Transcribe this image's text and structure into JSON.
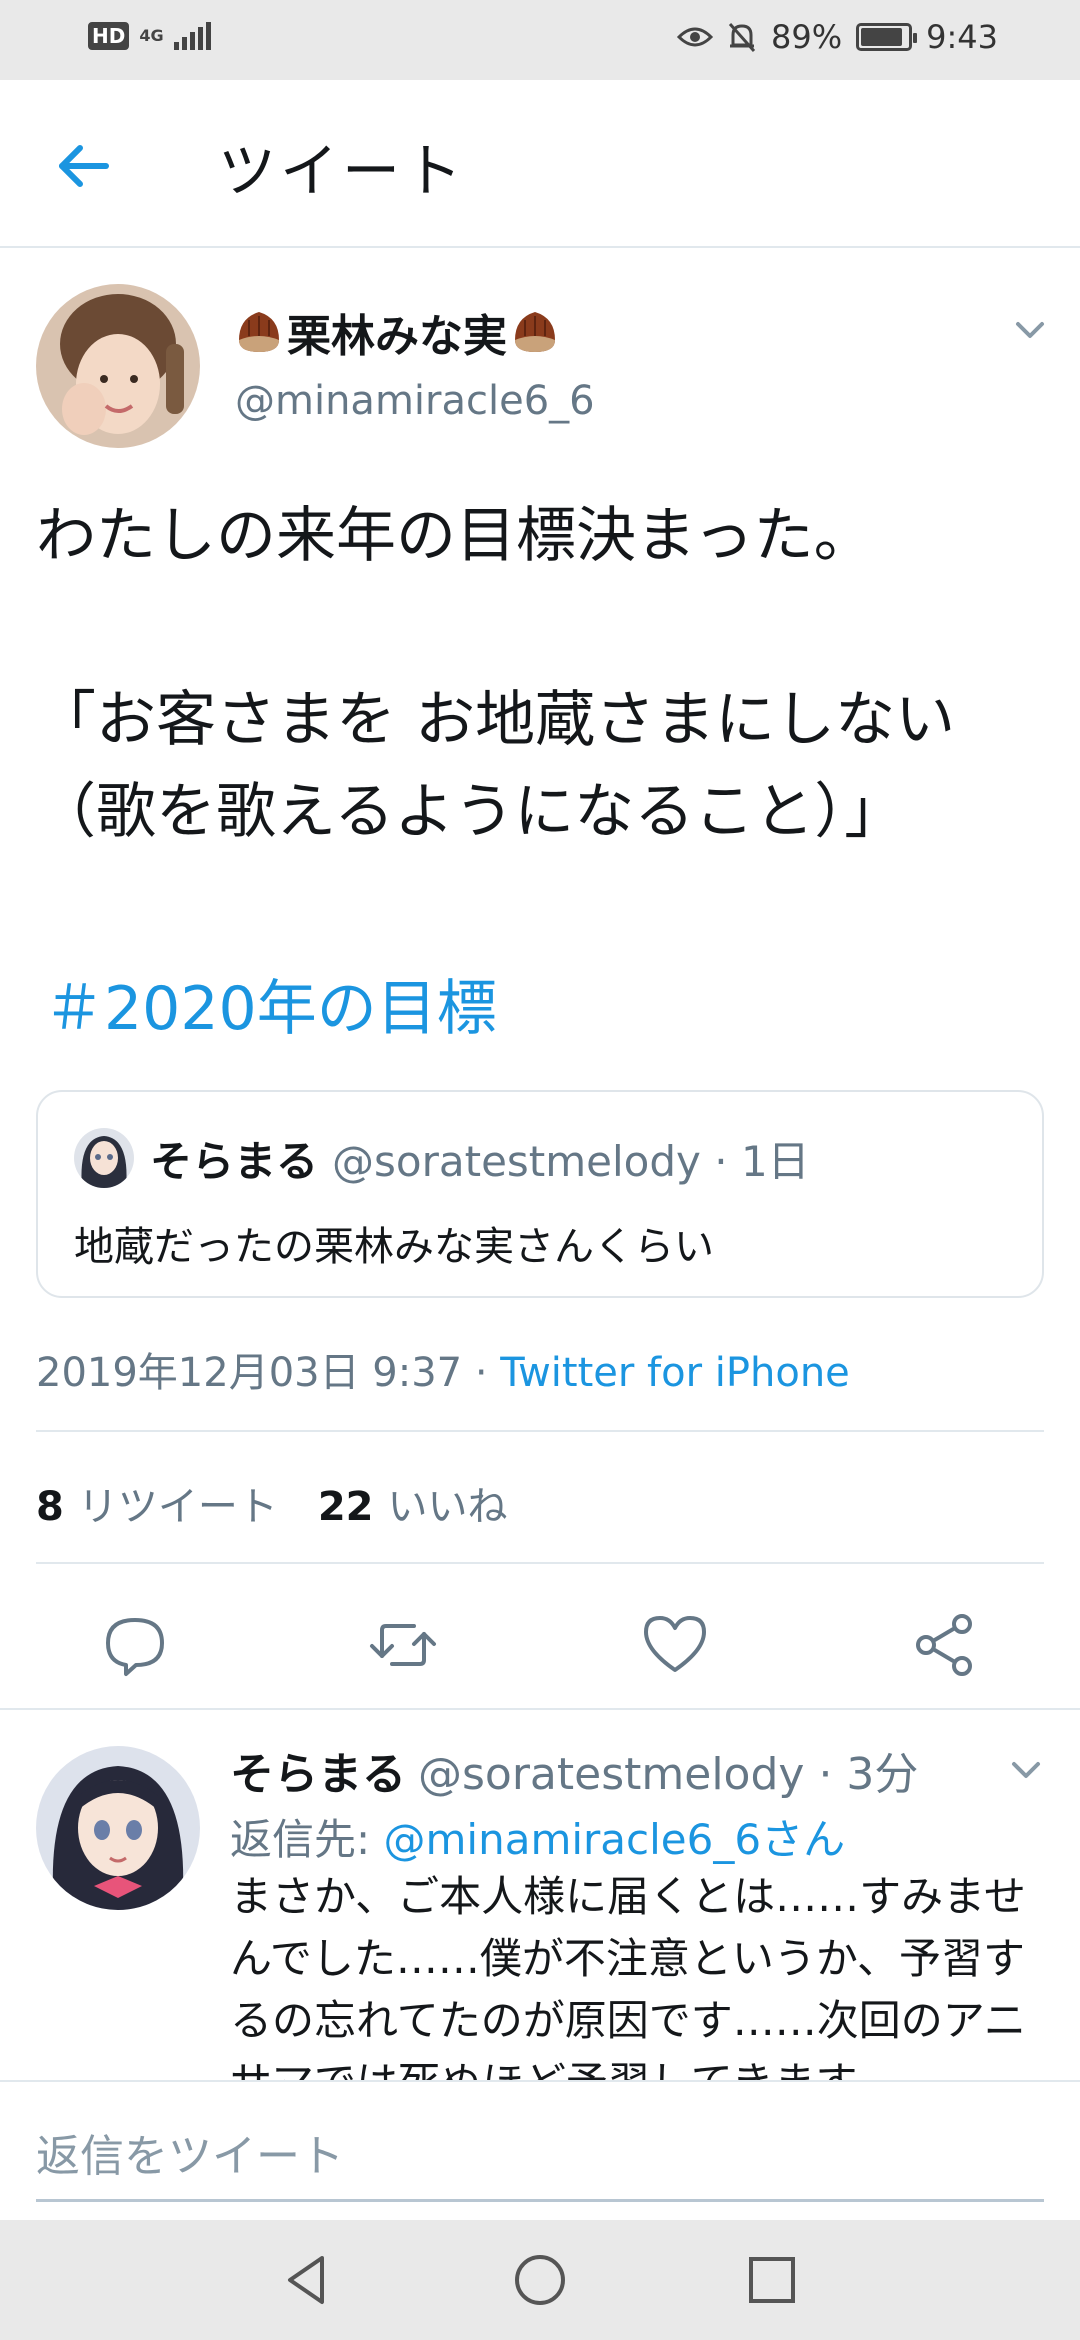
{
  "status_bar": {
    "hd": "HD",
    "network": "4G",
    "battery_percent": "89%",
    "battery_level": 0.89,
    "time": "9:43"
  },
  "header": {
    "title": "ツイート"
  },
  "tweet": {
    "author_name": "栗林みな実",
    "author_handle": "@minamiracle6_6",
    "text": "わたしの来年の目標決まった。\n\n「お客さまを お地蔵さまにしない\n（歌を歌えるようになること）」",
    "hashtag": "＃2020年の目標",
    "quoted": {
      "name": "そらまる",
      "handle": "@soratestmelody",
      "time": "· 1日",
      "text": "地蔵だったの栗林みな実さんくらい"
    },
    "timestamp": "2019年12月03日 9:37 · ",
    "source": "Twitter for iPhone",
    "retweets_count": "8",
    "retweets_label": "リツイート",
    "likes_count": "22",
    "likes_label": "いいね"
  },
  "reply": {
    "name": "そらまる",
    "handle": "@soratestmelody",
    "time": "· 3分",
    "reply_to_label": "返信先: ",
    "reply_to_handle": "@minamiracle6_6さん",
    "text": "まさか、ご本人様に届くとは……すみませんでした……僕が不注意というか、予習するの忘れてたのが原因です……次回のアニサマでは死ぬほど予習してきます"
  },
  "composer": {
    "placeholder": "返信をツイート"
  },
  "colors": {
    "link": "#1b95e0",
    "secondary_text": "#657786",
    "primary_text": "#14171a"
  }
}
